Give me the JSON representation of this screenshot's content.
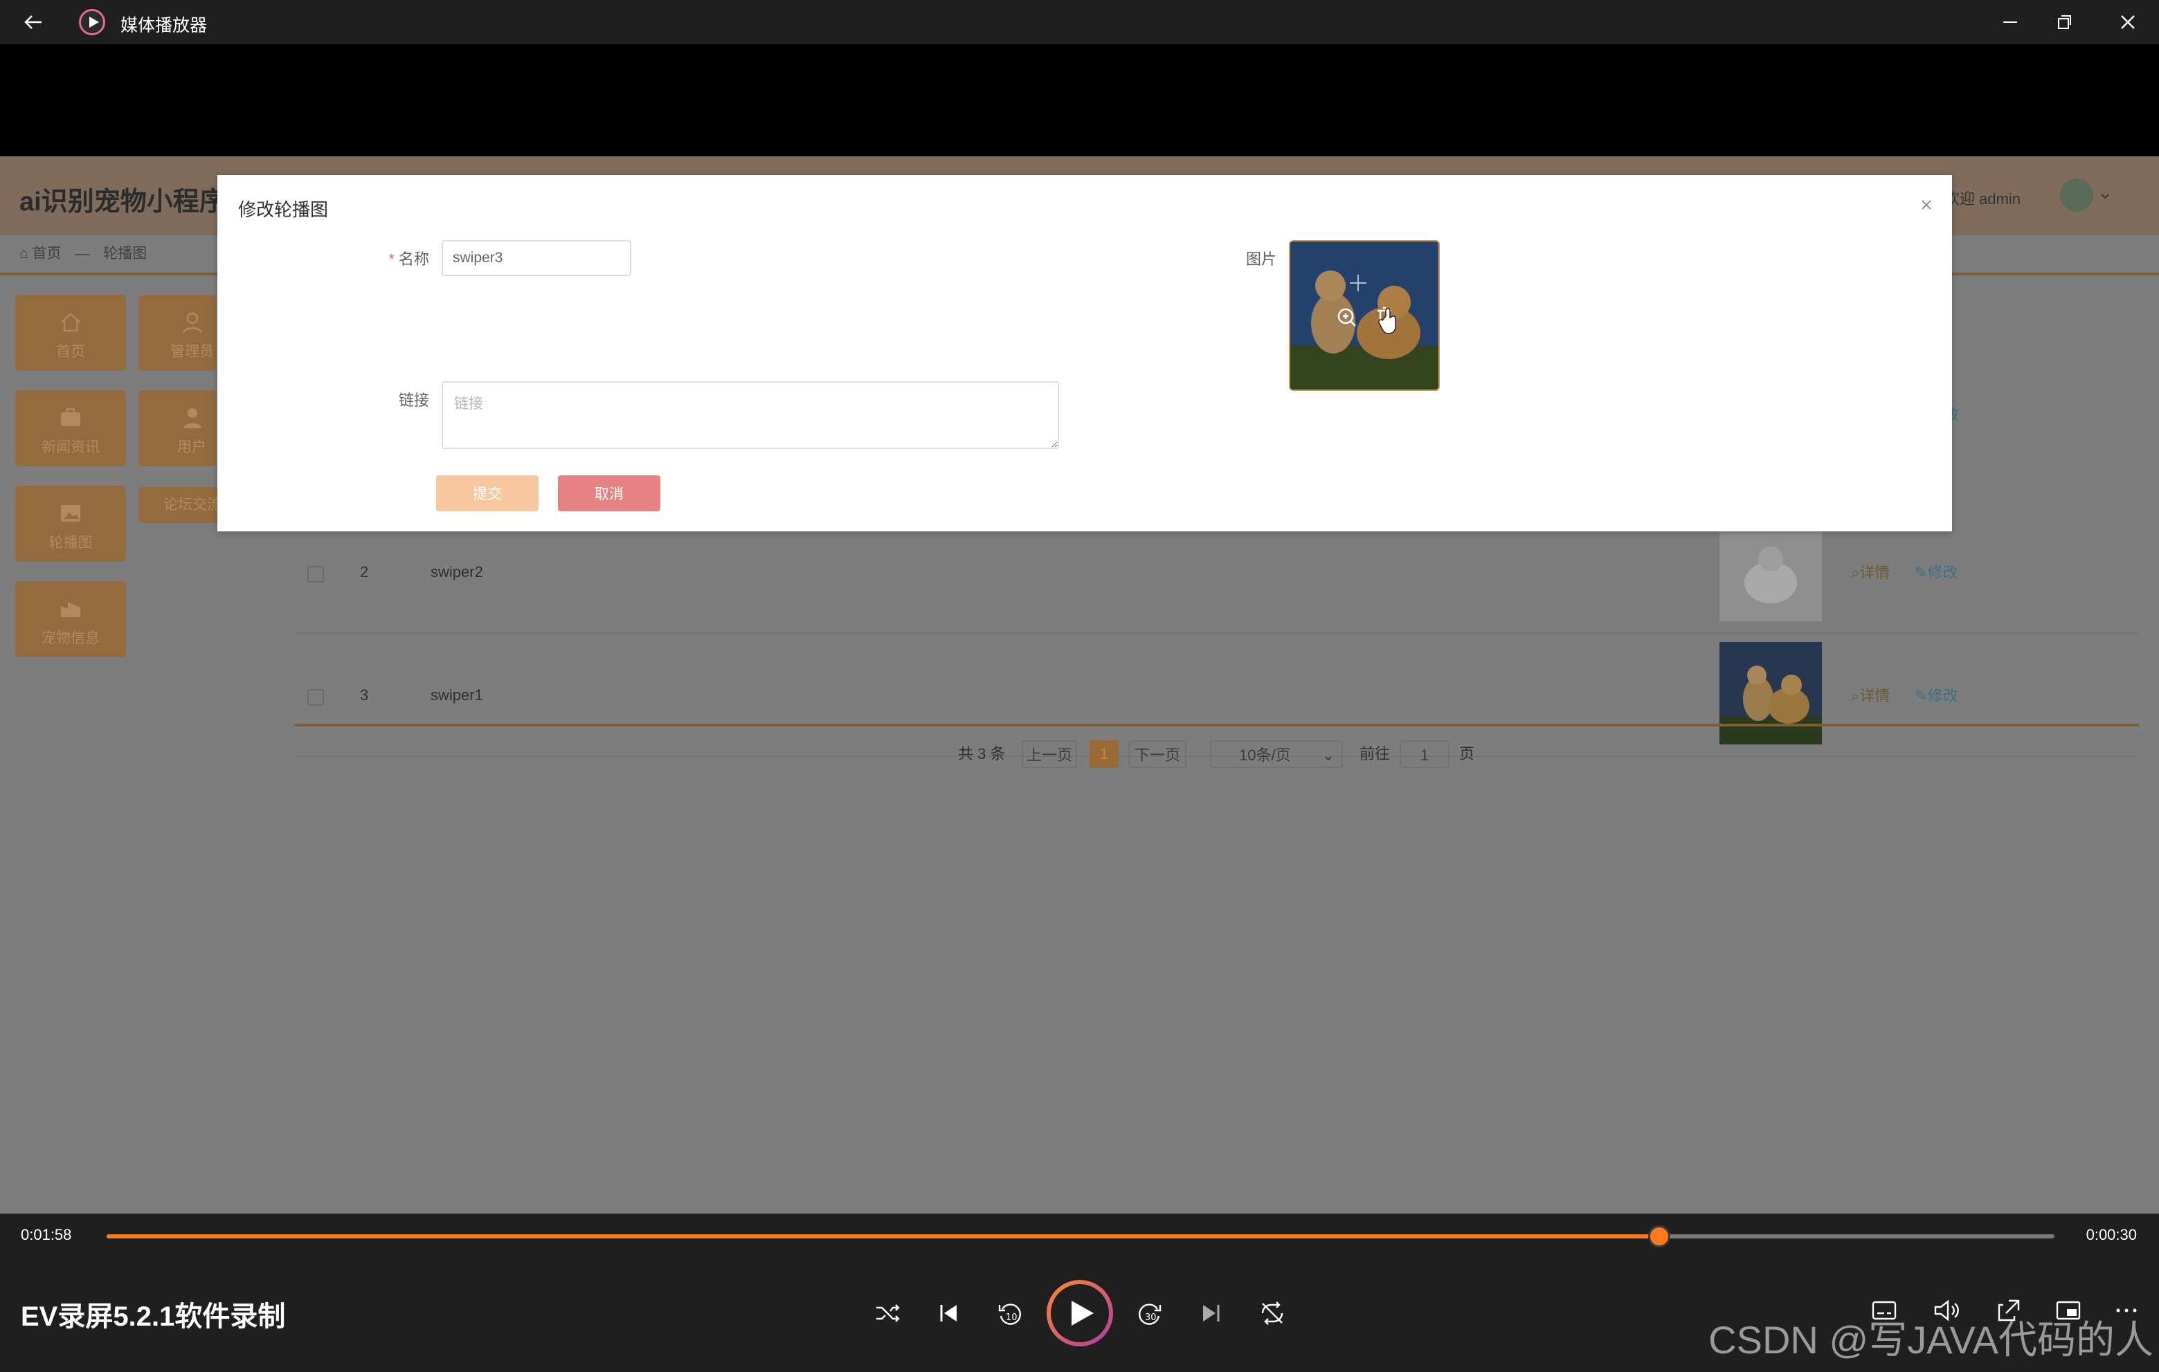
{
  "player_window": {
    "title": "媒体播放器",
    "icons": [
      "back-arrow-icon",
      "media-player-icon",
      "minimize-icon",
      "restore-icon",
      "close-icon"
    ]
  },
  "app": {
    "brand": "ai识别宠物小程序",
    "welcome": "欢迎 admin",
    "breadcrumb": {
      "home": "首页",
      "sep": "—",
      "current": "轮播图"
    },
    "nav": {
      "home": "首页",
      "admin": "管理员",
      "news": "新闻资讯",
      "user": "用户",
      "carousel": "轮播图",
      "forum": "论坛交流",
      "pets": "宠物信息"
    },
    "table_rows": [
      {
        "index": "2",
        "name": "swiper2",
        "detail": "详情",
        "edit": "修改"
      },
      {
        "index": "3",
        "name": "swiper1",
        "detail": "详情",
        "edit": "修改"
      }
    ],
    "first_row_edit_fragment": "改",
    "pagination": {
      "total": "共 3 条",
      "prev": "上一页",
      "current": "1",
      "next": "下一页",
      "page_size": "10条/页",
      "goto_prefix": "前往",
      "goto_value": "1",
      "goto_suffix": "页"
    }
  },
  "modal": {
    "title": "修改轮播图",
    "name_label": "名称",
    "name_value": "swiper3",
    "link_label": "链接",
    "link_placeholder": "链接",
    "image_label": "图片",
    "submit": "提交",
    "cancel": "取消"
  },
  "controls": {
    "elapsed": "0:01:58",
    "remaining": "0:00:30",
    "progress": 0.797,
    "media_title": "EV录屏5.2.1软件录制",
    "watermark": "CSDN @写JAVA代码的人",
    "accent": "#ff7a1a"
  }
}
